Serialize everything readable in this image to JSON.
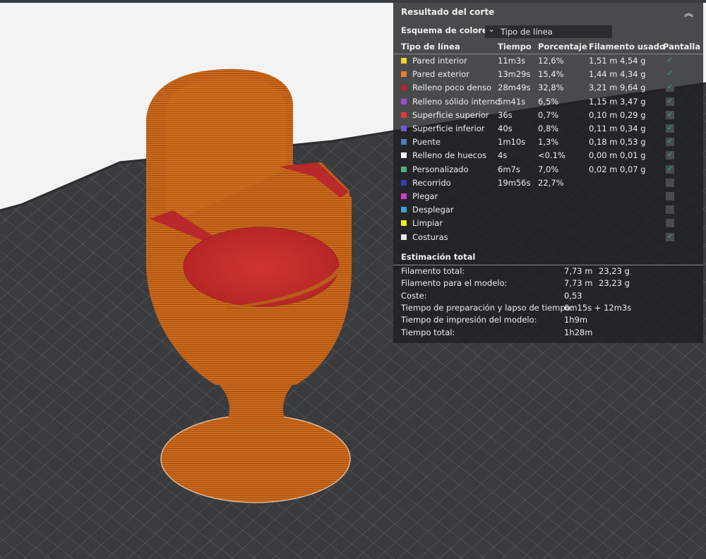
{
  "panel": {
    "title": "Resultado del corte",
    "color_scheme_label": "Esquema de colores",
    "color_scheme_value": "Tipo de línea",
    "columns": {
      "type": "Tipo de línea",
      "time": "Tiempo",
      "percent": "Porcentaje",
      "filament": "Filamento usado",
      "display": "Pantalla"
    },
    "rows": [
      {
        "label": "Pared interior",
        "color": "#f6d42b",
        "time": "11m3s",
        "percent": "12,6%",
        "length": "1,51 m",
        "weight": "4,54 g",
        "shown": true
      },
      {
        "label": "Pared exterior",
        "color": "#f07d2c",
        "time": "13m29s",
        "percent": "15,4%",
        "length": "1,44 m",
        "weight": "4,34 g",
        "shown": true
      },
      {
        "label": "Relleno poco denso",
        "color": "#b2272b",
        "time": "28m49s",
        "percent": "32,8%",
        "length": "3,21 m",
        "weight": "9,64 g",
        "shown": true
      },
      {
        "label": "Relleno sólido interno",
        "color": "#9a4fd2",
        "time": "5m41s",
        "percent": "6,5%",
        "length": "1,15 m",
        "weight": "3,47 g",
        "shown": true
      },
      {
        "label": "Superficie superior",
        "color": "#e5363c",
        "time": "36s",
        "percent": "0,7%",
        "length": "0,10 m",
        "weight": "0,29 g",
        "shown": true
      },
      {
        "label": "Superficie inferior",
        "color": "#6a5ccf",
        "time": "40s",
        "percent": "0,8%",
        "length": "0,11 m",
        "weight": "0,34 g",
        "shown": true
      },
      {
        "label": "Puente",
        "color": "#4a7fb8",
        "time": "1m10s",
        "percent": "1,3%",
        "length": "0,18 m",
        "weight": "0,53 g",
        "shown": true
      },
      {
        "label": "Relleno de huecos",
        "color": "#ffffff",
        "time": "4s",
        "percent": "<0.1%",
        "length": "0,00 m",
        "weight": "0,01 g",
        "shown": true
      },
      {
        "label": "Personalizado",
        "color": "#4fb07a",
        "time": "6m7s",
        "percent": "7,0%",
        "length": "0,02 m",
        "weight": "0,07 g",
        "shown": true
      },
      {
        "label": "Recorrido",
        "color": "#3a3fb0",
        "time": "19m56s",
        "percent": "22,7%",
        "length": "",
        "weight": "",
        "shown": false
      },
      {
        "label": "Plegar",
        "color": "#d23fd0",
        "time": "",
        "percent": "",
        "length": "",
        "weight": "",
        "shown": false
      },
      {
        "label": "Desplegar",
        "color": "#3aa3d0",
        "time": "",
        "percent": "",
        "length": "",
        "weight": "",
        "shown": false
      },
      {
        "label": "Limpiar",
        "color": "#f5ec1c",
        "time": "",
        "percent": "",
        "length": "",
        "weight": "",
        "shown": false
      },
      {
        "label": "Costuras",
        "color": "#e8e8e8",
        "time": "",
        "percent": "",
        "length": "",
        "weight": "",
        "shown": true
      }
    ],
    "estimate": {
      "title": "Estimación total",
      "rows": [
        {
          "label": "Filamento total:",
          "value": "7,73 m",
          "value2": "23,23 g"
        },
        {
          "label": "Filamento para el modelo:",
          "value": "7,73 m",
          "value2": "23,23 g"
        },
        {
          "label": "Coste:",
          "value": "0,53",
          "value2": ""
        },
        {
          "label": "Tiempo de preparación y lapso de tiempo:",
          "value": "6m15s + 12m3s",
          "value2": ""
        },
        {
          "label": "Tiempo de impresión del modelo:",
          "value": "1h9m",
          "value2": ""
        },
        {
          "label": "Tiempo total:",
          "value": "1h28m",
          "value2": ""
        }
      ]
    }
  },
  "icons": {
    "collapse": "double-chevron-up-icon",
    "dropdown": "chevron-down-icon",
    "checkbox": "check-icon"
  },
  "colors": {
    "plate": "#383a3c",
    "grid": "#5c5f61",
    "model_orange": "#c8661a",
    "model_red": "#c62f2c",
    "check_green": "#19c07a"
  }
}
